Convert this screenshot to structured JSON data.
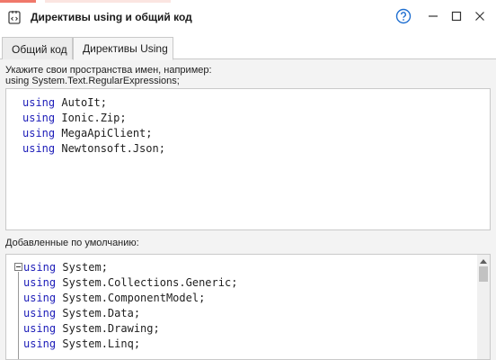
{
  "window": {
    "title": "Директивы using и общий код",
    "icon": "code-brackets-icon"
  },
  "controls": {
    "help": "help-circle-icon",
    "minimize": "minimize-icon",
    "maximize": "maximize-icon",
    "close": "close-icon"
  },
  "tabs": [
    {
      "label": "Общий код",
      "active": false
    },
    {
      "label": "Директивы Using",
      "active": true
    }
  ],
  "user_section": {
    "hint_line1": "Укажите свои пространства имен, например:",
    "hint_line2": "using System.Text.RegularExpressions;",
    "lines": [
      {
        "keyword": "using",
        "namespace": " AutoIt;"
      },
      {
        "keyword": "using",
        "namespace": " Ionic.Zip;"
      },
      {
        "keyword": "using",
        "namespace": " MegaApiClient;"
      },
      {
        "keyword": "using",
        "namespace": " Newtonsoft.Json;"
      }
    ]
  },
  "default_section": {
    "label": "Добавленные по умолчанию:",
    "lines": [
      {
        "keyword": "using",
        "namespace": " System;"
      },
      {
        "keyword": "using",
        "namespace": " System.Collections.Generic;"
      },
      {
        "keyword": "using",
        "namespace": " System.ComponentModel;"
      },
      {
        "keyword": "using",
        "namespace": " System.Data;"
      },
      {
        "keyword": "using",
        "namespace": " System.Drawing;"
      },
      {
        "keyword": "using",
        "namespace": " System.Linq;"
      }
    ]
  },
  "colors": {
    "keyword": "#1b1bb8",
    "accent": "#1f6fd1"
  }
}
